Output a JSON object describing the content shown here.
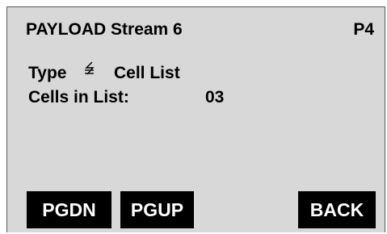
{
  "header": {
    "title": "PAYLOAD  Stream 6",
    "page": "P4"
  },
  "fields": {
    "type_label": "Type",
    "type_icon": "double-arrow-up-down-icon",
    "type_value": "Cell List",
    "cells_label": "Cells in List:",
    "cells_value": "03"
  },
  "softkeys": {
    "pgdn": "PGDN",
    "pgup": "PGUP",
    "back": "BACK"
  },
  "colors": {
    "screen_background": "#d8d8d8",
    "softkey_background": "#000000",
    "softkey_text": "#ffffff"
  }
}
